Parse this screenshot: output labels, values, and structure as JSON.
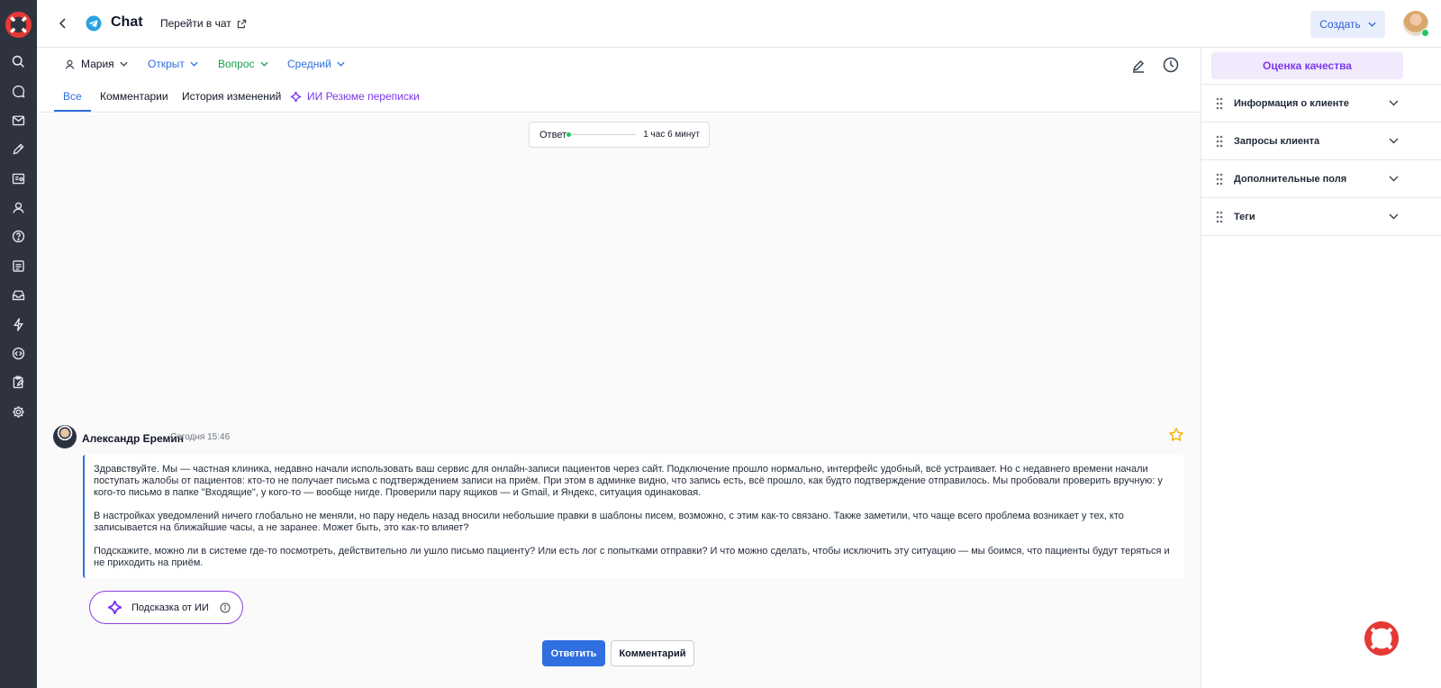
{
  "header": {
    "app_title": "Chat",
    "goto_label": "Перейти в чат",
    "create_label": "Создать"
  },
  "filters": {
    "user": "Мария",
    "status": "Открыт",
    "type": "Вопрос",
    "priority": "Средний"
  },
  "tabs": [
    {
      "label": "Все",
      "active": true
    },
    {
      "label": "Комментарии"
    },
    {
      "label": "История изменений"
    },
    {
      "label": "ИИ Резюме переписки"
    }
  ],
  "sla": {
    "label": "Ответ",
    "time": "1 час 6 минут"
  },
  "message": {
    "author": "Александр Еремин",
    "time": "Сегодня 15:46",
    "paragraphs": [
      "Здравствуйте. Мы — частная клиника, недавно начали использовать ваш сервис для онлайн-записи пациентов через сайт. Подключение прошло нормально, интерфейс удобный, всё устраивает. Но с недавнего времени начали поступать жалобы от пациентов: кто-то не получает письма с подтверждением записи на приём. При этом в админке видно, что запись есть, всё прошло, как будто подтверждение отправилось. Мы пробовали проверить вручную: у кого-то письмо в папке \"Входящие\", у кого-то — вообще нигде. Проверили пару ящиков — и Gmail, и Яндекс, ситуация одинаковая.",
      "В настройках уведомлений ничего глобально не меняли, но пару недель назад вносили небольшие правки в шаблоны писем, возможно, с этим как-то связано. Также заметили, что чаще всего проблема возникает у тех, кто записывается на ближайшие часы, а не заранее. Может быть, это как-то влияет?",
      "Подскажите, можно ли в системе где-то посмотреть, действительно ли ушло письмо пациенту? Или есть лог с попытками отправки? И что можно сделать, чтобы исключить эту ситуацию — мы боимся, что пациенты будут теряться и не приходить на приём."
    ]
  },
  "ai_hint_label": "Подсказка от ИИ",
  "actions": {
    "reply": "Ответить",
    "comment": "Комментарий"
  },
  "right_panel": {
    "quality_label": "Оценка качества",
    "sections": [
      "Информация о клиенте",
      "Запросы клиента",
      "Дополнительные поля",
      "Теги"
    ]
  },
  "icons": {
    "logo": "lifebuoy-icon",
    "sidebar": [
      "search-icon",
      "chat-icon",
      "mail-icon",
      "pen-icon",
      "knowledge-icon",
      "user-icon",
      "help-icon",
      "list-icon",
      "inbox-icon",
      "bolt-icon",
      "code-icon",
      "clipboard-icon",
      "gear-icon"
    ]
  },
  "colors": {
    "sidebar_bg": "#2f3340",
    "accent_blue": "#2f6fe0",
    "accent_green": "#16a34a",
    "ai_purple": "#7c3aed",
    "logo_red": "#e53935",
    "star": "#f5b400"
  }
}
